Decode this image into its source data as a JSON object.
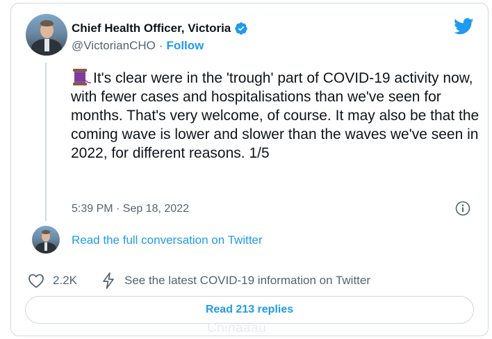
{
  "author": {
    "name": "Chief Health Officer, Victoria",
    "handle": "@VictorianCHO",
    "separator": "·",
    "follow_label": "Follow"
  },
  "tweet": {
    "text": "It's clear were in the 'trough' part of COVID-19 activity now, with fewer cases and hospitalisations than we've seen for months. That's very welcome, of course. It may also be that the coming wave is lower and slower than the waves we've seen in 2022, for different reasons. 1/5",
    "timestamp": "5:39 PM · Sep 18, 2022"
  },
  "conversation": {
    "read_full_label": "Read the full conversation on Twitter"
  },
  "actions": {
    "like_count": "2.2K",
    "covid_info_label": "See the latest COVID-19 information on Twitter"
  },
  "replies": {
    "button_label": "Read 213 replies"
  },
  "watermark": "Chinaaau",
  "colors": {
    "accent": "#1d9bf0",
    "text": "#0f1419",
    "secondary": "#536471",
    "border": "#cfd9de"
  },
  "icons": {
    "verified": "verified-badge-icon",
    "brand": "twitter-bird-icon",
    "emoji": "spool-of-thread-icon",
    "info": "info-icon",
    "like": "heart-icon",
    "covid": "lightning-bolt-icon"
  }
}
